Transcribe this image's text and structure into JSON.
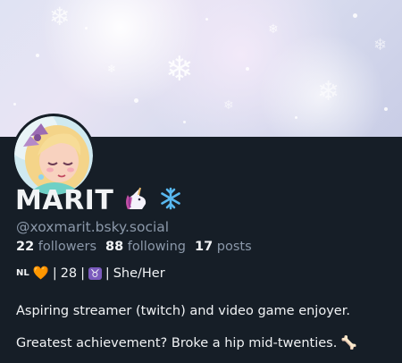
{
  "profile": {
    "display_name": "MARIT",
    "name_emoji_1": "unicorn-icon",
    "name_emoji_2": "snowflake-icon",
    "handle": "@xoxmarit.bsky.social",
    "stats": {
      "followers_count": "22",
      "followers_label": "followers",
      "following_count": "88",
      "following_label": "following",
      "posts_count": "17",
      "posts_label": "posts"
    },
    "meta": {
      "country": "NL",
      "heart": "🧡",
      "age": "28",
      "sign": "♉",
      "pronouns": "She/Her"
    },
    "bio": {
      "line1": "Aspiring streamer (twitch) and video game enjoyer.",
      "line2": "Greatest achievement? Broke a hip mid-twenties. 🦴"
    }
  },
  "colors": {
    "background": "#161e27",
    "text": "#f1f3f5",
    "muted": "#8b98a9"
  }
}
